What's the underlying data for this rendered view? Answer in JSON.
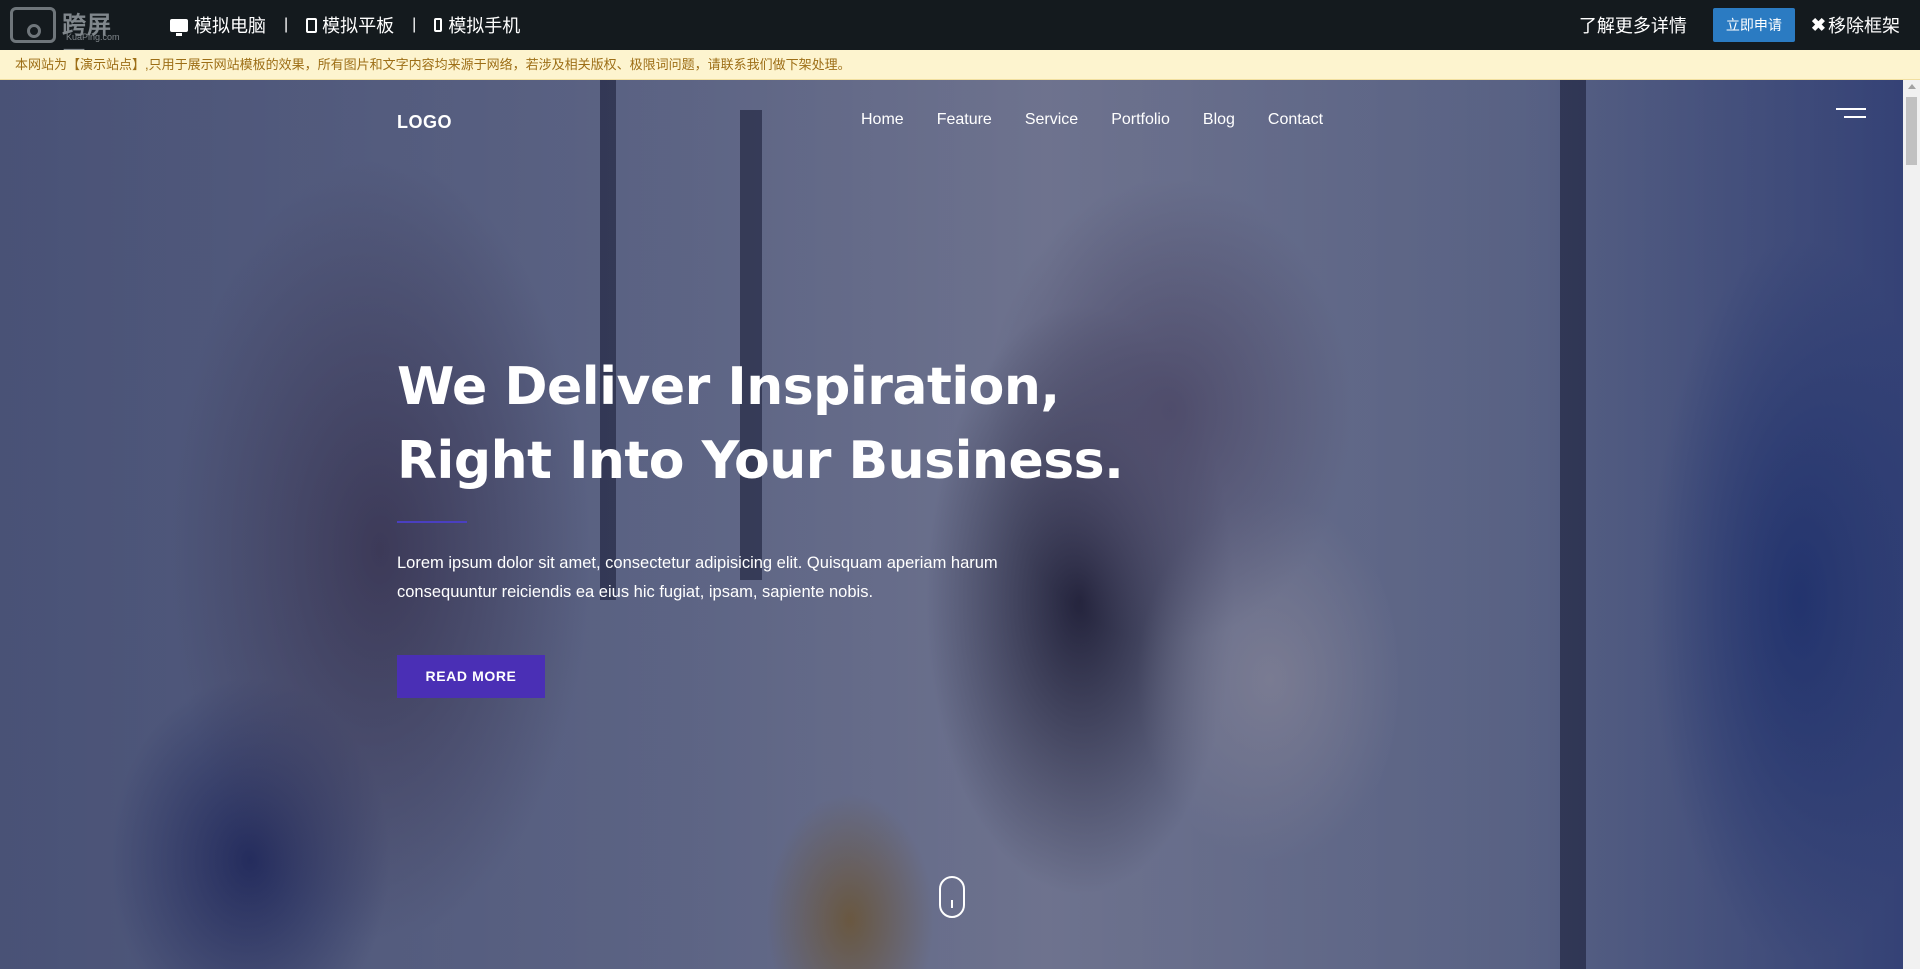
{
  "topbar": {
    "logo_cn": "跨屏网",
    "logo_en": "KuaPing.com",
    "devices": [
      {
        "label": "模拟电脑",
        "icon": "monitor-icon"
      },
      {
        "label": "模拟平板",
        "icon": "tablet-icon"
      },
      {
        "label": "模拟手机",
        "icon": "phone-icon"
      }
    ],
    "separator": "|",
    "learn_more": "了解更多详情",
    "apply": "立即申请",
    "remove_frame": "移除框架",
    "remove_icon": "✖",
    "colors": {
      "background": "#141a1e",
      "apply_button": "#2b7bc2"
    }
  },
  "notice": {
    "text": "本网站为【演示站点】,只用于展示网站模板的效果，所有图片和文字内容均来源于网络，若涉及相关版权、极限词问题，请联系我们做下架处理。",
    "colors": {
      "background": "#fdf4cf",
      "text": "#9d6e16"
    }
  },
  "site": {
    "logo": "LOGO",
    "menu": [
      "Home",
      "Feature",
      "Service",
      "Portfolio",
      "Blog",
      "Contact"
    ],
    "hero": {
      "headline_line1": "We Deliver Inspiration,",
      "headline_line2": "Right Into Your Business.",
      "lead": "Lorem ipsum dolor sit amet, consectetur adipisicing elit. Quisquam aperiam harum consequuntur reiciendis ea eius hic fugiat, ipsam, sapiente nobis.",
      "button": "READ MORE"
    },
    "colors": {
      "accent": "#4a2fb5",
      "overlay": "#1e2146"
    }
  }
}
